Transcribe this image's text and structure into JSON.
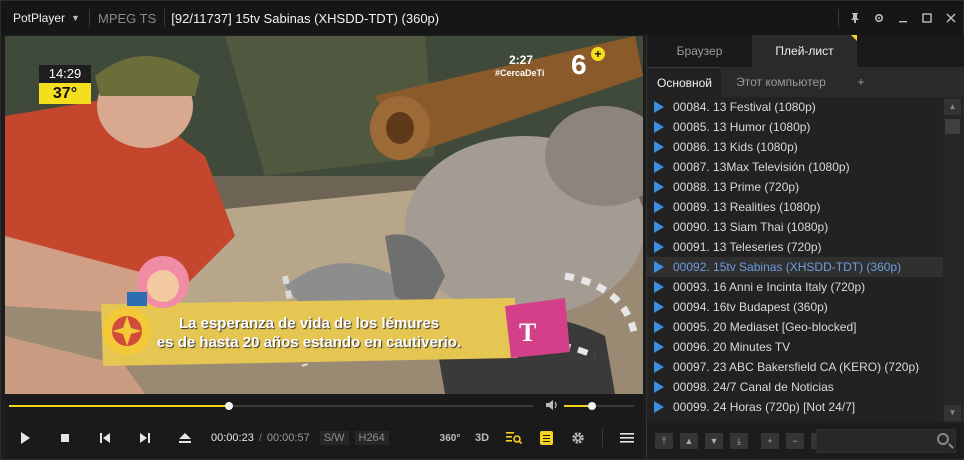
{
  "app": {
    "name": "PotPlayer",
    "format": "MPEG TS",
    "title": "[92/11737] 15tv Sabinas (XHSDD-TDT) (360p)",
    "icons": [
      "pin-icon",
      "settings-icon",
      "minimize-icon",
      "maximize-icon",
      "close-icon"
    ]
  },
  "video": {
    "clock_time": "14:29",
    "clock_temp": "37°",
    "logo_time": "2:27",
    "logo_hashtag": "#CercaDeTi",
    "logo_channel": "6",
    "logo_plus": "+",
    "subtitle_line1": "La esperanza de vida de los lémures",
    "subtitle_line2": "es de hasta 20 años estando en cautiverio.",
    "badge_letter": "T"
  },
  "seek": {
    "progress_percent": 42,
    "volume_percent": 40
  },
  "controls": {
    "current_time": "00:00:23",
    "separator": "/",
    "total_time": "00:00:57",
    "decoder": "S/W",
    "codec": "H264",
    "vr_label": "360°",
    "threed_label": "3D"
  },
  "panel": {
    "tabs": [
      "Браузер",
      "Плей-лист"
    ],
    "active_tab": 1,
    "subtabs": [
      "Основной",
      "Этот компьютер",
      "+"
    ],
    "active_subtab": 0,
    "items": [
      "00084. 13 Festival (1080p)",
      "00085. 13 Humor (1080p)",
      "00086. 13 Kids (1080p)",
      "00087. 13Max Televisión (1080p)",
      "00088. 13 Prime (720p)",
      "00089. 13 Realities (1080p)",
      "00090. 13 Siam Thai (1080p)",
      "00091. 13 Teleseries (720p)",
      "00092. 15tv Sabinas (XHSDD-TDT) (360p)",
      "00093. 16 Anni e Incinta Italy (720p)",
      "00094. 16tv Budapest (360p)",
      "00095. 20 Mediaset [Geo-blocked]",
      "00096. 20 Minutes TV",
      "00097. 23 ABC Bakersfield CA (KERO) (720p)",
      "00098. 24/7 Canal de Noticias",
      "00099. 24 Horas (720p) [Not 24/7]"
    ],
    "current_index": 8
  },
  "colors": {
    "accent": "#f5d21f",
    "current_text": "#6e9be0",
    "play_mark": "#3c8fe0"
  }
}
